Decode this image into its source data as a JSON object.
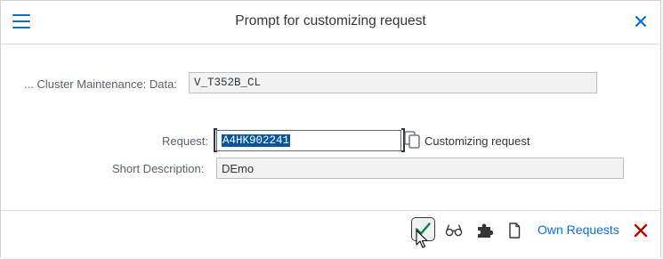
{
  "dialog": {
    "title": "Prompt for customizing request"
  },
  "fields": {
    "object_label": "... Cluster Maintenance: Data:",
    "object_value": "V_T352B_CL",
    "request_label": "Request:",
    "request_value": "A4HK902241",
    "request_hint": "Customizing request",
    "description_label": "Short Description:",
    "description_value": "DEmo"
  },
  "footer": {
    "own_requests_label": "Own Requests"
  },
  "icons": {
    "menu": "hamburger-menu-icon",
    "close": "close-icon",
    "value_help": "value-help-icon",
    "ok": "checkmark-icon",
    "display": "glasses-icon",
    "create": "puzzle-piece-icon",
    "new": "document-icon",
    "cancel": "cancel-icon"
  },
  "colors": {
    "accent": "#0a6ed1",
    "ok_green": "#107e3e",
    "cancel_red": "#bb0000",
    "selection": "#0854a0"
  }
}
